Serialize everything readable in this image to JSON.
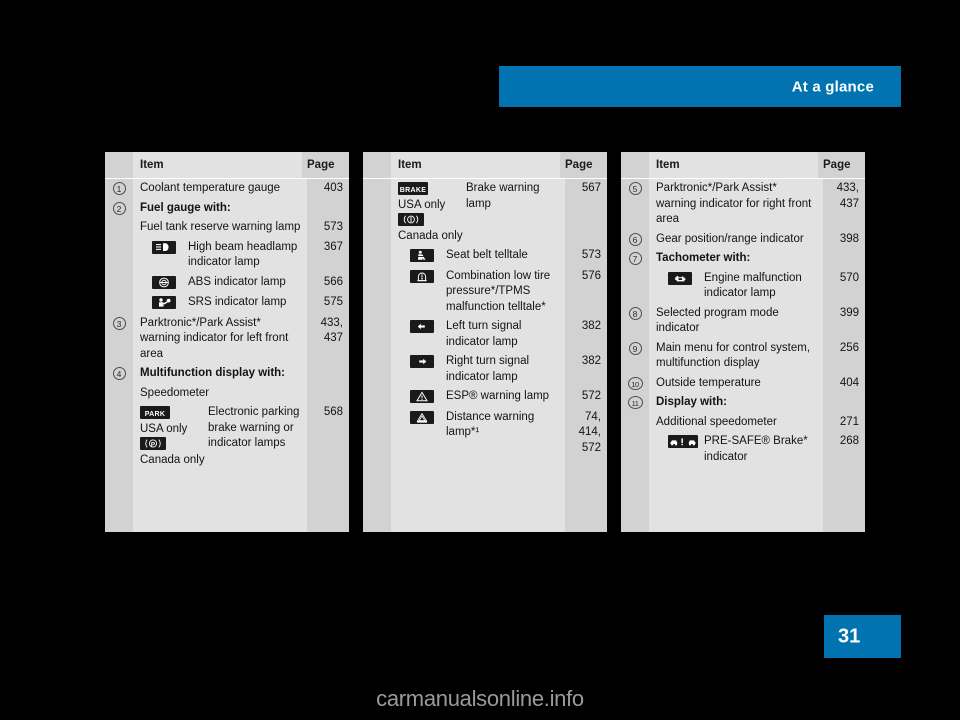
{
  "header": {
    "title": "At a glance",
    "accent_color": "#0073b0"
  },
  "page_badge": {
    "number": "31"
  },
  "watermark": {
    "text": "carmanualsonline.info"
  },
  "table_headers": {
    "item": "Item",
    "page": "Page"
  },
  "columns": [
    {
      "id": "column-1",
      "rows": [
        {
          "num": "1",
          "item": "Coolant temperature gauge",
          "page": "403"
        },
        {
          "num": "2",
          "item": "Fuel gauge with:",
          "bold": true,
          "page": ""
        },
        {
          "item": "Fuel tank reserve warning lamp",
          "page": "573"
        },
        {
          "icon": "high-beam-headlamp-icon",
          "item": "High beam headlamp indicator lamp",
          "page": "367"
        },
        {
          "icon": "abs-icon",
          "item": "ABS indicator lamp",
          "page": "566"
        },
        {
          "icon": "srs-airbag-icon",
          "item": "SRS indicator lamp",
          "page": "575"
        },
        {
          "num": "3",
          "item": "Parktronic*/Park Assist* warning indicator for left front area",
          "page": "433,\n437"
        },
        {
          "num": "4",
          "item": "Multifunction display with:",
          "bold": true,
          "page": ""
        },
        {
          "item": "Speedometer",
          "page": ""
        },
        {
          "dual": true,
          "icon_usa": "park-text-icon",
          "label_usa": "USA only",
          "icon_canada": "parking-brake-p-icon",
          "label_canada": "Canada only",
          "item": "Electronic parking brake warning or indicator lamps",
          "page": "568"
        }
      ]
    },
    {
      "id": "column-2",
      "rows": [
        {
          "dual": true,
          "icon_usa": "brake-text-icon",
          "label_usa": "USA only",
          "icon_canada": "brake-circle-icon",
          "label_canada": "Canada only",
          "item": "Brake warning lamp",
          "page": "567"
        },
        {
          "icon": "seat-belt-icon",
          "item": "Seat belt telltale",
          "page": "573"
        },
        {
          "icon": "tire-pressure-icon",
          "item": "Combination low tire pressure*/TPMS malfunction telltale*",
          "page": "576"
        },
        {
          "icon": "left-turn-signal-icon",
          "item": "Left turn signal indicator lamp",
          "page": "382"
        },
        {
          "icon": "right-turn-signal-icon",
          "item": "Right turn signal indicator lamp",
          "page": "382"
        },
        {
          "icon": "esp-warning-icon",
          "item": "ESP® warning lamp",
          "page": "572"
        },
        {
          "icon": "distance-warning-icon",
          "item": "Distance warning lamp*¹",
          "page": "74,\n414,\n572"
        }
      ]
    },
    {
      "id": "column-3",
      "rows": [
        {
          "num": "5",
          "item": "Parktronic*/Park Assist* warning indicator for right front area",
          "page": "433,\n437"
        },
        {
          "num": "6",
          "item": "Gear position/range indicator",
          "page": "398"
        },
        {
          "num": "7",
          "item": "Tachometer with:",
          "bold": true,
          "page": ""
        },
        {
          "icon": "engine-malfunction-icon",
          "item": "Engine malfunction indicator lamp",
          "page": "570"
        },
        {
          "num": "8",
          "item": "Selected program mode indicator",
          "page": "399"
        },
        {
          "num": "9",
          "item": "Main menu for control system, multifunction display",
          "page": "256"
        },
        {
          "num": "10",
          "item": "Outside temperature",
          "page": "404"
        },
        {
          "num": "11",
          "item": "Display with:",
          "bold": true,
          "page": ""
        },
        {
          "item": "Additional speedometer",
          "page": "271"
        },
        {
          "icon": "pre-safe-brake-icon",
          "item": "PRE-SAFE® Brake* indicator",
          "page": "268"
        }
      ]
    }
  ]
}
